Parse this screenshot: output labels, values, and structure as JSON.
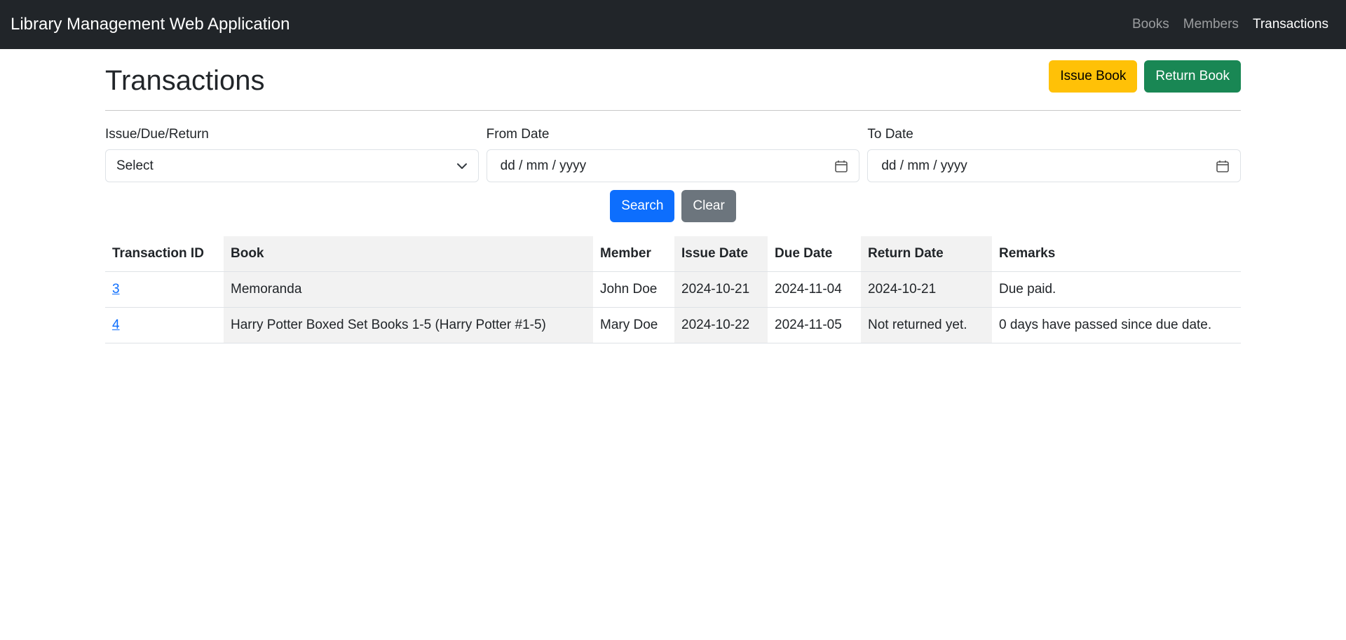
{
  "nav": {
    "brand": "Library Management Web Application",
    "links": [
      "Books",
      "Members",
      "Transactions"
    ]
  },
  "page": {
    "title": "Transactions",
    "issue_button": "Issue Book",
    "return_button": "Return Book"
  },
  "filters": {
    "type_label": "Issue/Due/Return",
    "type_value": "Select",
    "from_label": "From Date",
    "from_placeholder": "dd / mm / yyyy",
    "to_label": "To Date",
    "to_placeholder": "dd / mm / yyyy",
    "search_button": "Search",
    "clear_button": "Clear"
  },
  "table": {
    "headers": [
      "Transaction ID",
      "Book",
      "Member",
      "Issue Date",
      "Due Date",
      "Return Date",
      "Remarks"
    ],
    "rows": [
      [
        "3",
        "Memoranda",
        "John Doe",
        "2024-10-21",
        "2024-11-04",
        "2024-10-21",
        "Due paid."
      ],
      [
        "4",
        "Harry Potter Boxed Set Books 1-5 (Harry Potter #1-5)",
        "Mary Doe",
        "2024-10-22",
        "2024-11-05",
        "Not returned yet.",
        "0 days have passed since due date."
      ]
    ]
  },
  "colors": {
    "navbar": "#212529",
    "warning": "#ffc107",
    "success": "#198754",
    "primary": "#0d6efd",
    "secondary": "#6c757d"
  }
}
